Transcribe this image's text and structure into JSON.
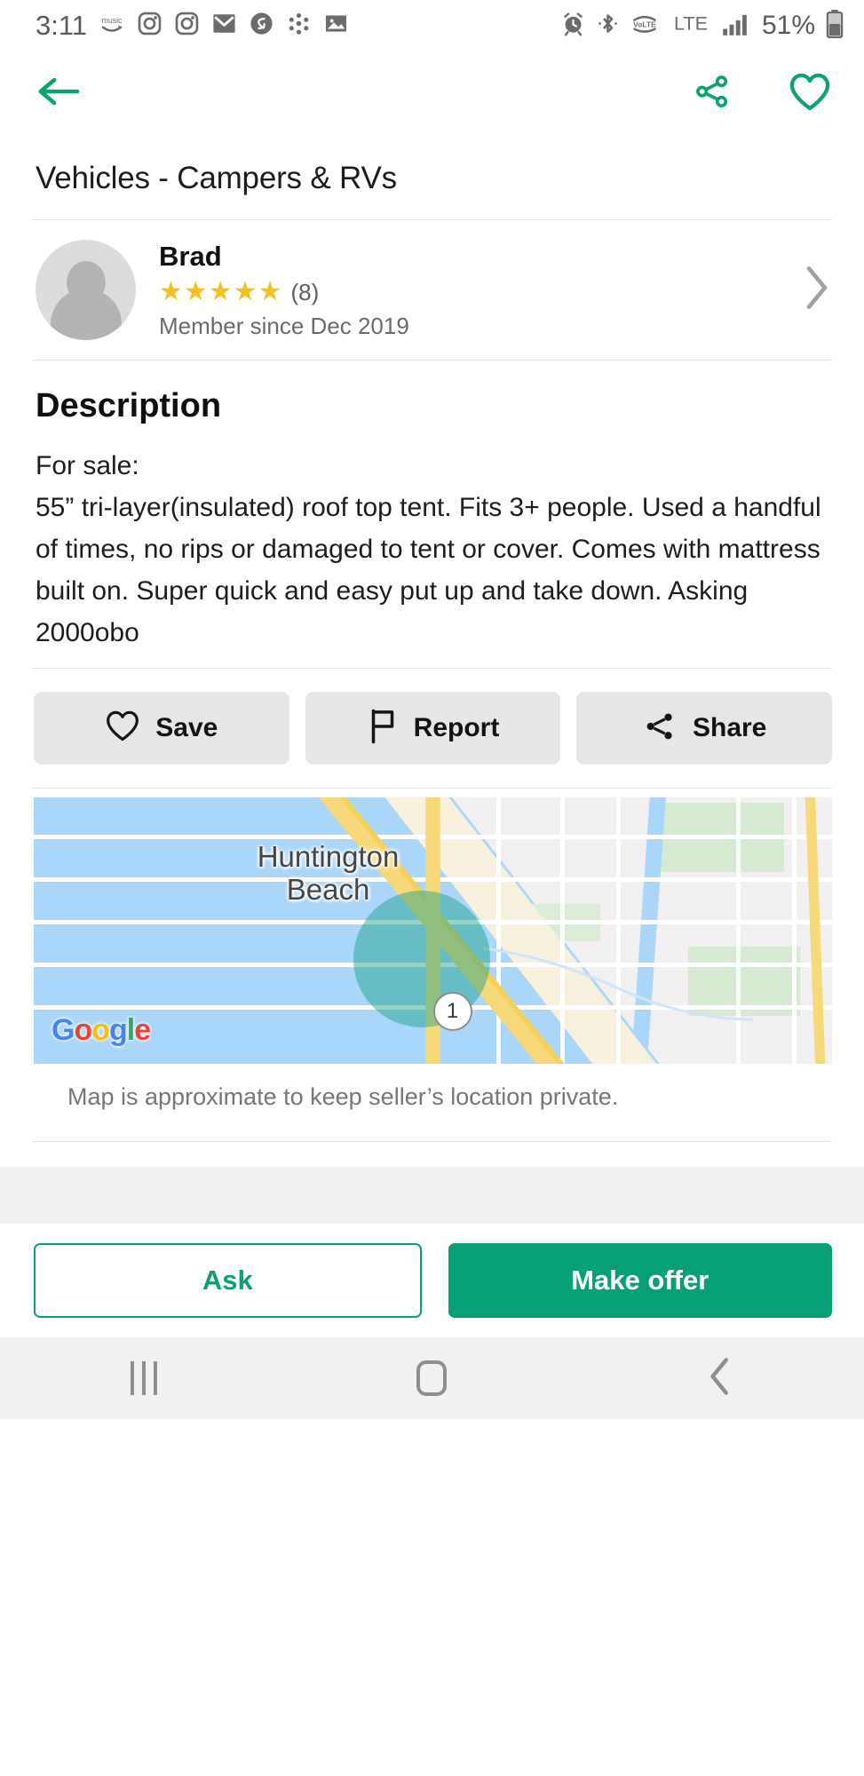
{
  "status_bar": {
    "time": "3:11",
    "left_icons": [
      "amazon-music-icon",
      "instagram-icon",
      "instagram-icon",
      "email-icon",
      "shazam-icon",
      "flower-app-icon",
      "photos-icon"
    ],
    "right_icons": [
      "alarm-icon",
      "bluetooth-icon",
      "volte-icon",
      "signal-bars-icon"
    ],
    "volte_label": "VoLTE",
    "network_label": "LTE",
    "battery_percent": "51%"
  },
  "top_nav": {
    "back_icon": "back-arrow-icon",
    "share_icon": "share-icon",
    "favorite_icon": "heart-outline-icon"
  },
  "listing": {
    "category": "Vehicles - Campers & RVs"
  },
  "seller": {
    "name": "Brad",
    "stars": "★★★★★",
    "star_count": 5,
    "review_count": "(8)",
    "member_since": "Member since Dec 2019",
    "avatar_icon": "person-placeholder-avatar",
    "chevron_icon": "chevron-right-icon"
  },
  "description": {
    "heading": "Description",
    "body": "For sale:\n55” tri-layer(insulated) roof top tent. Fits 3+ people. Used a handful of times, no rips or damaged to tent or cover. Comes with mattress built on. Super quick and easy put up and take down. Asking 2000obo"
  },
  "actions": [
    {
      "label": "Save",
      "icon": "heart-outline-icon"
    },
    {
      "label": "Report",
      "icon": "flag-icon"
    },
    {
      "label": "Share",
      "icon": "share-icon"
    }
  ],
  "map": {
    "city_label_line1": "Huntington",
    "city_label_line2": "Beach",
    "marker_number": "1",
    "attribution": "Google",
    "note": "Map is approximate to keep seller’s location private.",
    "water_color": "#a9d6f9",
    "land_color": "#f2eff1",
    "highway_color": "#f7d97a",
    "radius_color": "#16a085"
  },
  "bottom_bar": {
    "ask_label": "Ask",
    "offer_label": "Make offer",
    "accent_color": "#07a076"
  },
  "android_nav": {
    "recents_icon": "recents-icon",
    "home_icon": "home-icon",
    "back_icon": "back-chevron-icon"
  }
}
